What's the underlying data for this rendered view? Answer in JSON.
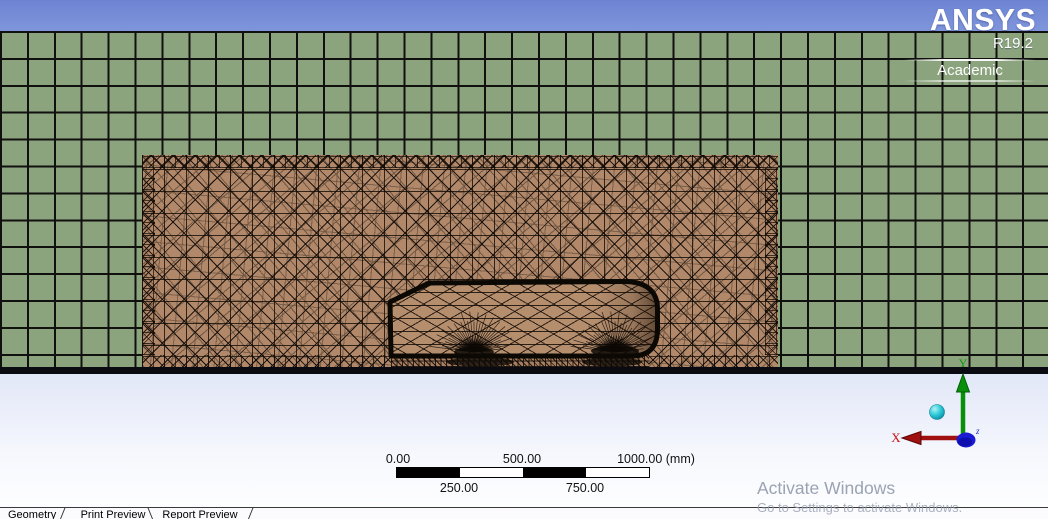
{
  "logo": {
    "brand": "ANSYS",
    "version": "R19.2",
    "edition": "Academic"
  },
  "scale_ruler": {
    "top": [
      "0.00",
      "500.00",
      "1000.00 (mm)"
    ],
    "bottom": [
      "250.00",
      "750.00"
    ]
  },
  "triad": {
    "x_label": "X",
    "y_label": "Y",
    "z_label": "z"
  },
  "watermark": {
    "line1": "Activate Windows",
    "line2": "Go to Settings to activate Windows."
  },
  "tabs": {
    "geometry": "Geometry",
    "print_preview": "Print Preview",
    "report_preview": "Report Preview"
  },
  "colors": {
    "top_blue": "#7188d5",
    "grid_green": "#8ba47d",
    "mesh_tan": "#b1896a",
    "ground_black": "#0a0a12",
    "triad_x_red": "#b01212",
    "triad_y_green": "#0a9a0a",
    "triad_z_blue": "#1a1ad2",
    "sphere_cyan": "#2cc8d8",
    "watermark_gray": "#8a93a6"
  }
}
